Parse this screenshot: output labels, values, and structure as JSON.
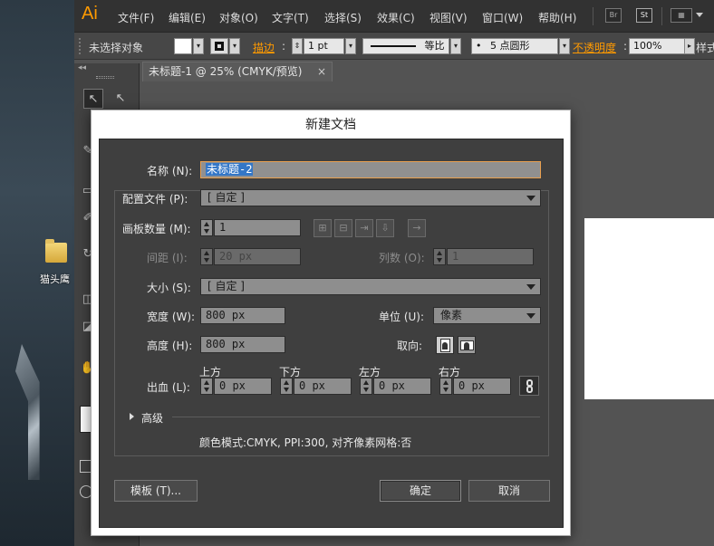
{
  "desktop": {
    "folder_label": "猫头鹰"
  },
  "app": {
    "logo": "Ai"
  },
  "menubar": {
    "items": [
      "文件(F)",
      "编辑(E)",
      "对象(O)",
      "文字(T)",
      "选择(S)",
      "效果(C)",
      "视图(V)",
      "窗口(W)",
      "帮助(H)"
    ],
    "bridge": "Br",
    "stock": "St"
  },
  "control_bar": {
    "selection": "未选择对象",
    "stroke_label": "描边",
    "stroke_weight": "1 pt",
    "profile": "等比",
    "brush": "5 点圆形",
    "opacity_label": "不透明度",
    "opacity": "100%",
    "style_label": "样式"
  },
  "document_tab": {
    "title": "未标题-1 @ 25% (CMYK/预览)",
    "close": "×"
  },
  "dialog": {
    "title": "新建文档",
    "name_label": "名称 (N):",
    "name_value": "未标题-2",
    "profile_label": "配置文件 (P):",
    "profile_value": "[ 自定 ]",
    "artboards_label": "画板数量 (M):",
    "artboards_value": "1",
    "spacing_label": "间距 (I):",
    "spacing_value": "20 px",
    "columns_label": "列数 (O):",
    "columns_value": "1",
    "size_label": "大小 (S):",
    "size_value": "[ 自定 ]",
    "width_label": "宽度 (W):",
    "width_value": "800 px",
    "units_label": "单位 (U):",
    "units_value": "像素",
    "height_label": "高度 (H):",
    "height_value": "800 px",
    "orientation_label": "取向:",
    "bleed_label": "出血 (L):",
    "bleed": [
      {
        "label": "上方",
        "value": "0 px"
      },
      {
        "label": "下方",
        "value": "0 px"
      },
      {
        "label": "左方",
        "value": "0 px"
      },
      {
        "label": "右方",
        "value": "0 px"
      }
    ],
    "advanced_label": "高级",
    "summary": "颜色模式:CMYK, PPI:300, 对齐像素网格:否",
    "templates_button": "模板 (T)...",
    "ok_button": "确定",
    "cancel_button": "取消"
  }
}
